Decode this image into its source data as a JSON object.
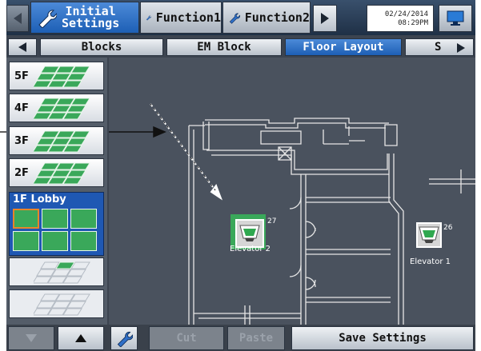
{
  "header": {
    "tabs": [
      {
        "label": "Initial Settings",
        "line1": "Initial",
        "line2": "Settings",
        "active": true,
        "icon": "wrench-icon"
      },
      {
        "label": "Function1",
        "active": false,
        "icon": "wrench-icon"
      },
      {
        "label": "Function2",
        "active": false,
        "icon": "wrench-icon"
      }
    ],
    "date": "02/24/2014",
    "time": "08:29PM"
  },
  "subtabs": [
    {
      "label": "Blocks",
      "active": false
    },
    {
      "label": "EM Block",
      "active": false
    },
    {
      "label": "Floor Layout",
      "active": true
    },
    {
      "label": "S",
      "active": false
    }
  ],
  "floors": [
    {
      "label": "5F"
    },
    {
      "label": "4F"
    },
    {
      "label": "3F"
    },
    {
      "label": "2F"
    }
  ],
  "selected_floor": {
    "label": "1F Lobby"
  },
  "map": {
    "units": [
      {
        "number": "27",
        "name": "Elevator 2",
        "selected": true
      },
      {
        "number": "26",
        "name": "Elevator 1",
        "selected": false
      }
    ]
  },
  "bottom": {
    "cut_label": "Cut",
    "paste_label": "Paste",
    "save_label": "Save Settings"
  },
  "colors": {
    "accent": "#1d5fb5",
    "unit_green": "#3aa85a",
    "selection_orange": "#e8842a"
  }
}
